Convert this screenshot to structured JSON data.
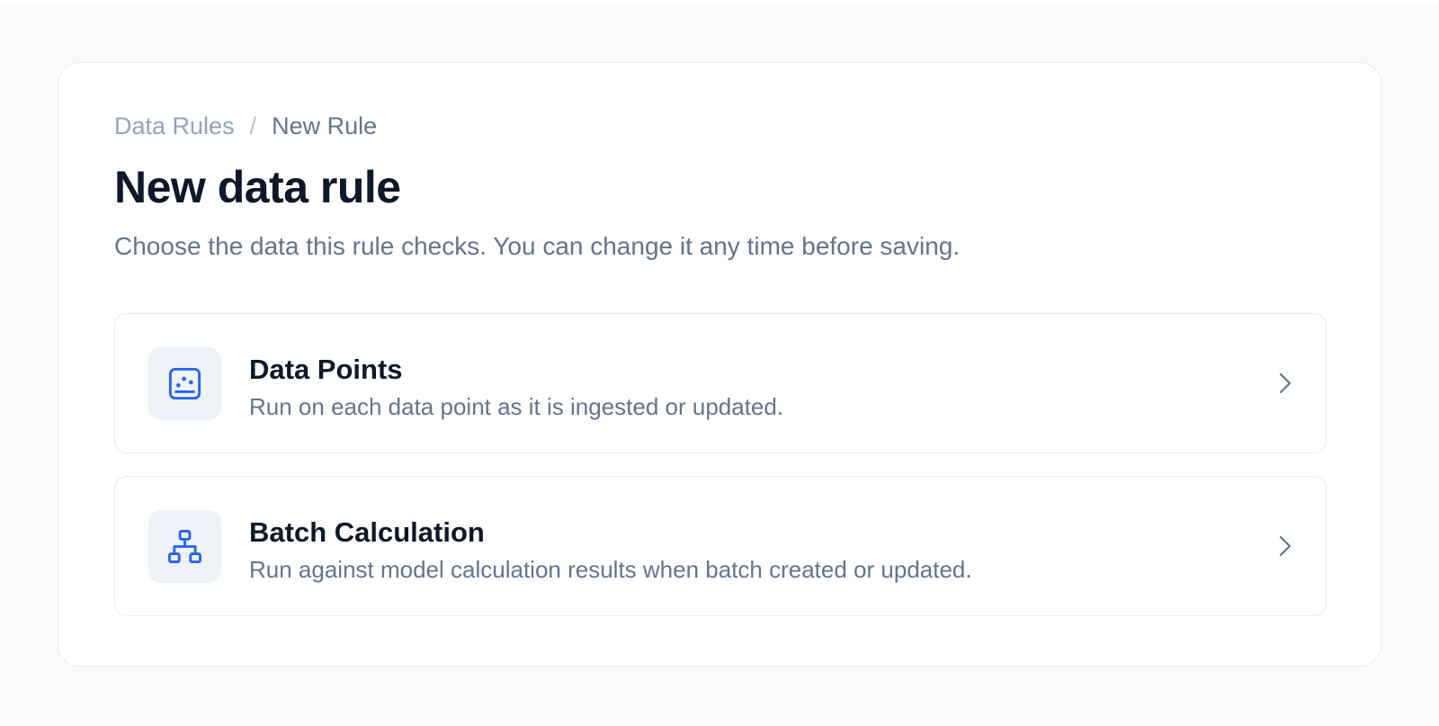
{
  "breadcrumb": {
    "parent": "Data Rules",
    "separator": "/",
    "current": "New Rule"
  },
  "page": {
    "title": "New data rule",
    "subtitle": "Choose the data this rule checks. You can change it any time before saving."
  },
  "options": [
    {
      "title": "Data Points",
      "description": "Run on each data point as it is ingested or updated.",
      "icon": "data-points-icon"
    },
    {
      "title": "Batch Calculation",
      "description": "Run against model calculation results when batch created or updated.",
      "icon": "hierarchy-icon"
    }
  ],
  "colors": {
    "accent": "#2563eb",
    "icon_bg": "#eef3fa",
    "title": "#0f172a",
    "muted": "#64748b"
  }
}
